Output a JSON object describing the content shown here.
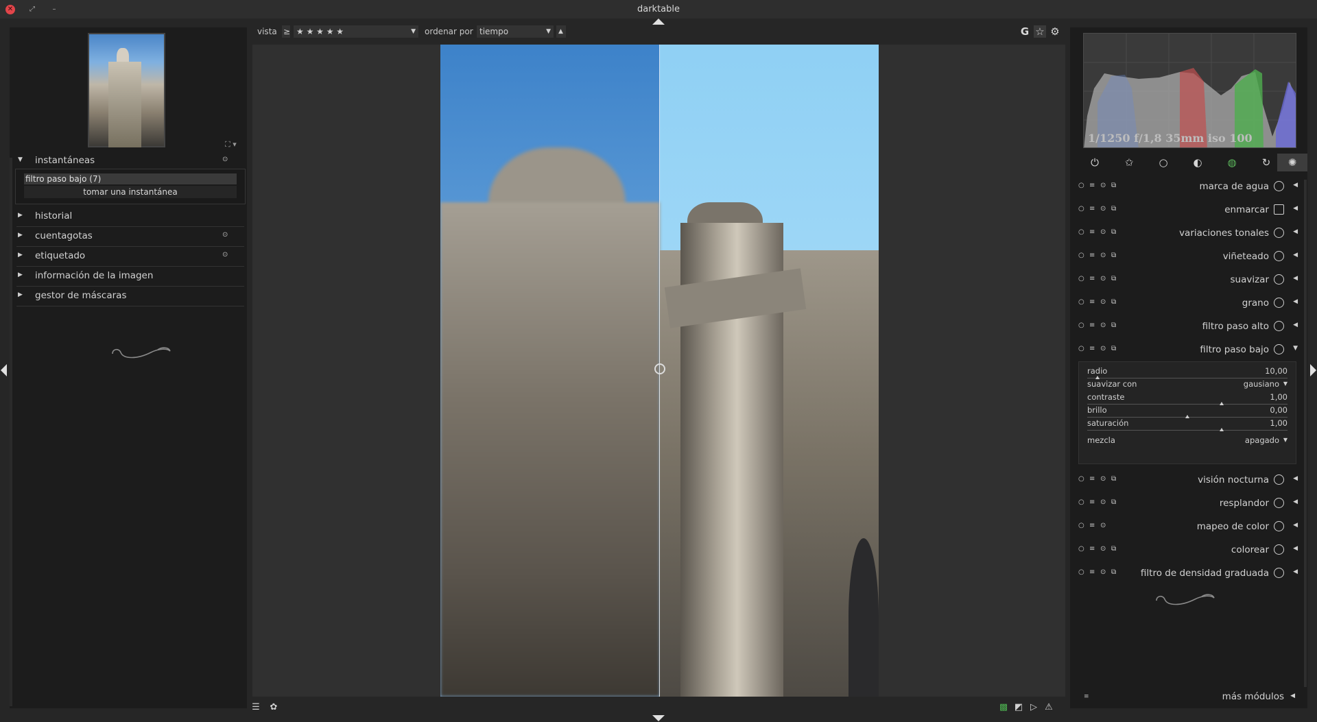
{
  "window": {
    "title": "darktable"
  },
  "left": {
    "snapshots": {
      "label": "instantáneas",
      "item": "filtro paso bajo (7)",
      "button": "tomar una instantánea"
    },
    "sections": [
      {
        "label": "historial"
      },
      {
        "label": "cuentagotas"
      },
      {
        "label": "etiquetado"
      },
      {
        "label": "información de la imagen"
      },
      {
        "label": "gestor de máscaras"
      }
    ]
  },
  "toolbar": {
    "view_label": "vista",
    "comparator": "≥",
    "rating": "★ ★ ★ ★ ★",
    "sort_label": "ordenar por",
    "sort_value": "tiempo",
    "sort_dir": "▲",
    "grouping": "G"
  },
  "histogram": {
    "exif": "1/1250 f/1,8 35mm iso 100"
  },
  "modules": [
    {
      "name": "marca de agua"
    },
    {
      "name": "enmarcar"
    },
    {
      "name": "variaciones tonales"
    },
    {
      "name": "viñeteado"
    },
    {
      "name": "suavizar"
    },
    {
      "name": "grano"
    },
    {
      "name": "filtro paso alto"
    },
    {
      "name": "filtro paso bajo"
    },
    {
      "name": "visión nocturna"
    },
    {
      "name": "resplandor"
    },
    {
      "name": "mapeo de color"
    },
    {
      "name": "colorear"
    },
    {
      "name": "filtro de densidad graduada"
    }
  ],
  "lowpass": {
    "radio": {
      "label": "radio",
      "value": "10,00",
      "fraction": 0.05
    },
    "suavizar": {
      "label": "suavizar con",
      "value": "gausiano"
    },
    "contraste": {
      "label": "contraste",
      "value": "1,00",
      "fraction": 0.67
    },
    "brillo": {
      "label": "brillo",
      "value": "0,00",
      "fraction": 0.5
    },
    "saturacion": {
      "label": "saturación",
      "value": "1,00",
      "fraction": 0.67
    },
    "mezcla": {
      "label": "mezcla",
      "value": "apagado"
    }
  },
  "more_modules": "más módulos"
}
